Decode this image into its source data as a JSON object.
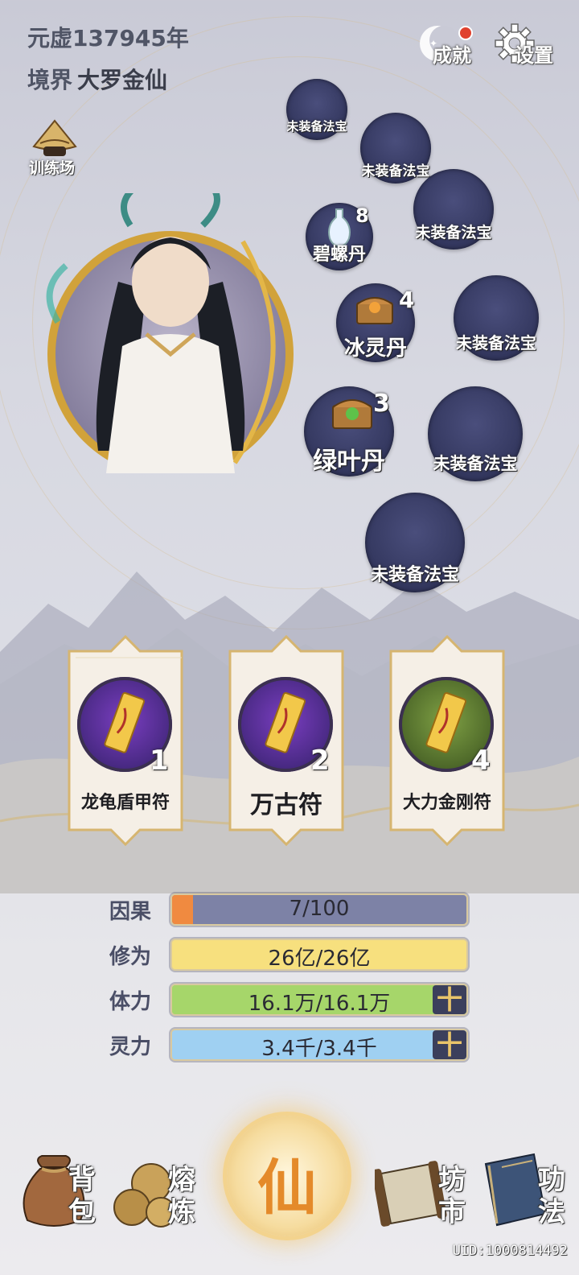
{
  "header": {
    "era": "元虚137945年",
    "realm_label": "境界",
    "realm_value": "大罗金仙",
    "achievements_label": "成就",
    "settings_label": "设置"
  },
  "training_ground": {
    "label": "训练场",
    "icon": "straw-hat-icon"
  },
  "artifact_slots": [
    {
      "label": "未装备法宝"
    },
    {
      "label": "未装备法宝"
    },
    {
      "label": "碧螺丹",
      "count": "8",
      "icon": "vase-icon"
    },
    {
      "label": "未装备法宝"
    },
    {
      "label": "冰灵丹",
      "count": "4",
      "icon": "treasure-chest-icon"
    },
    {
      "label": "未装备法宝"
    },
    {
      "label": "绿叶丹",
      "count": "3",
      "icon": "treasure-chest-icon"
    },
    {
      "label": "未装备法宝"
    },
    {
      "label": "未装备法宝"
    }
  ],
  "talismans": [
    {
      "name": "龙龟盾甲符",
      "count": "1",
      "icon": "talisman-icon"
    },
    {
      "name": "万古符",
      "count": "2",
      "icon": "talisman-icon"
    },
    {
      "name": "大力金刚符",
      "count": "4",
      "icon": "talisman-icon"
    }
  ],
  "stats": [
    {
      "label": "因果",
      "value": "7/100",
      "fill": 0.07,
      "color": "#7d82a6",
      "fill_color": "#f08a40"
    },
    {
      "label": "修为",
      "value": "26亿/26亿",
      "fill": 1.0,
      "color": "#f7e07e",
      "fill_color": "#f7e07e"
    },
    {
      "label": "体力",
      "value": "16.1万/16.1万",
      "fill": 1.0,
      "color": "#a6d66a",
      "fill_color": "#a6d66a"
    },
    {
      "label": "灵力",
      "value": "3.4千/3.4千",
      "fill": 1.0,
      "color": "#9fd0f2",
      "fill_color": "#9fd0f2"
    }
  ],
  "plus_symbol": "十",
  "bottom_nav": {
    "bag": "背包",
    "smelt": "熔炼",
    "immortal": "仙",
    "market": "坊市",
    "skills": "功法"
  },
  "uid": "UID:1000814492"
}
